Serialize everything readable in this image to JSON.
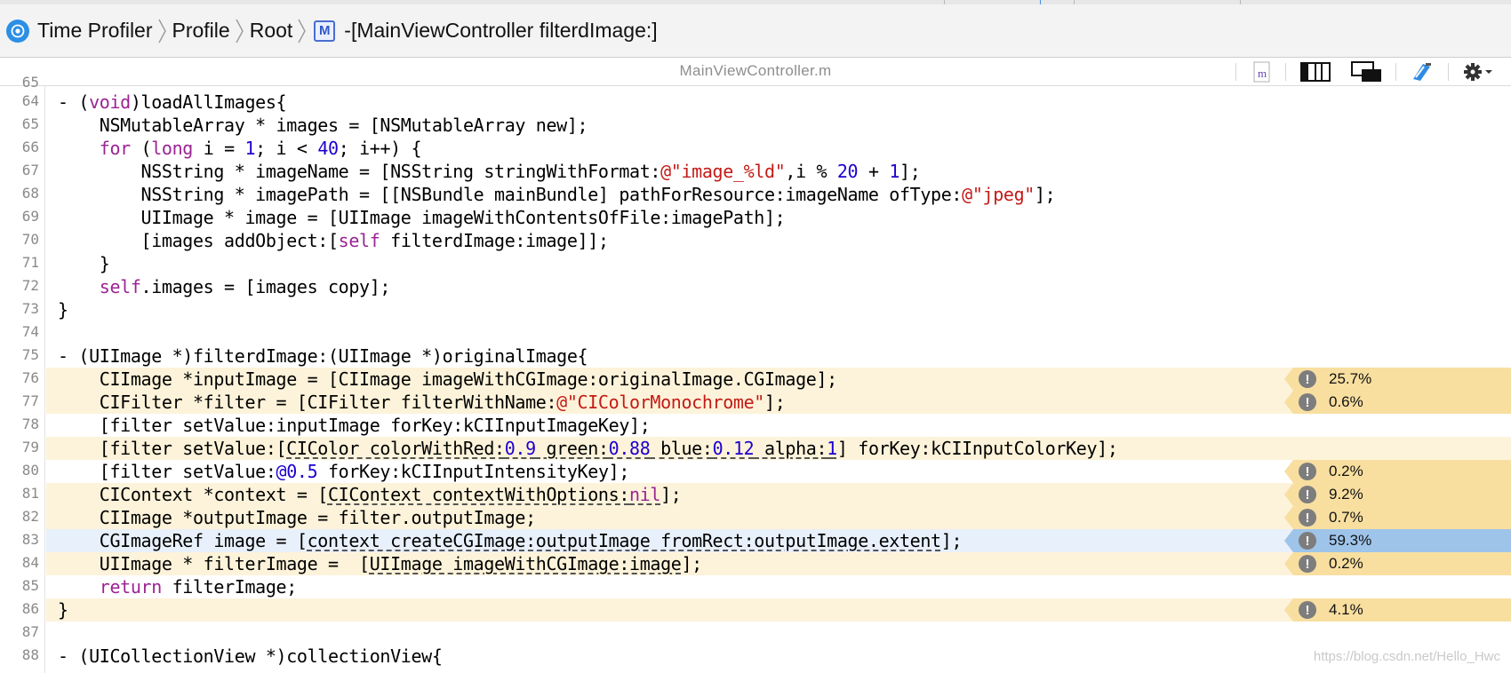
{
  "breadcrumb": {
    "items": [
      "Time Profiler",
      "Profile",
      "Root",
      "-[MainViewController filterdImage:]"
    ]
  },
  "file": {
    "name": "MainViewController.m"
  },
  "colors": {
    "line_highlight": "#fdf3da",
    "badge": "#f8dfa0",
    "selected_line": "#e8f0fb",
    "selected_badge": "#9fc4ea"
  },
  "code_lines": [
    {
      "n": "65"
    },
    {
      "n": "64"
    },
    {
      "n": "65"
    },
    {
      "n": "66"
    },
    {
      "n": "67"
    },
    {
      "n": "68"
    },
    {
      "n": "69"
    },
    {
      "n": "70"
    },
    {
      "n": "71"
    },
    {
      "n": "72"
    },
    {
      "n": "73"
    },
    {
      "n": "74"
    },
    {
      "n": "75"
    },
    {
      "n": "76"
    },
    {
      "n": "77"
    },
    {
      "n": "78"
    },
    {
      "n": "79"
    },
    {
      "n": "80"
    },
    {
      "n": "81"
    },
    {
      "n": "82"
    },
    {
      "n": "83"
    },
    {
      "n": "84"
    },
    {
      "n": "85"
    },
    {
      "n": "86"
    },
    {
      "n": "87"
    },
    {
      "n": "88"
    }
  ],
  "percentages": {
    "l76": "25.7%",
    "l77": "0.6%",
    "l80": "0.2%",
    "l81": "9.2%",
    "l82": "0.7%",
    "l83": "59.3%",
    "l84": "0.2%",
    "l86": "4.1%"
  },
  "watermark": "https://blog.csdn.net/Hello_Hwc"
}
